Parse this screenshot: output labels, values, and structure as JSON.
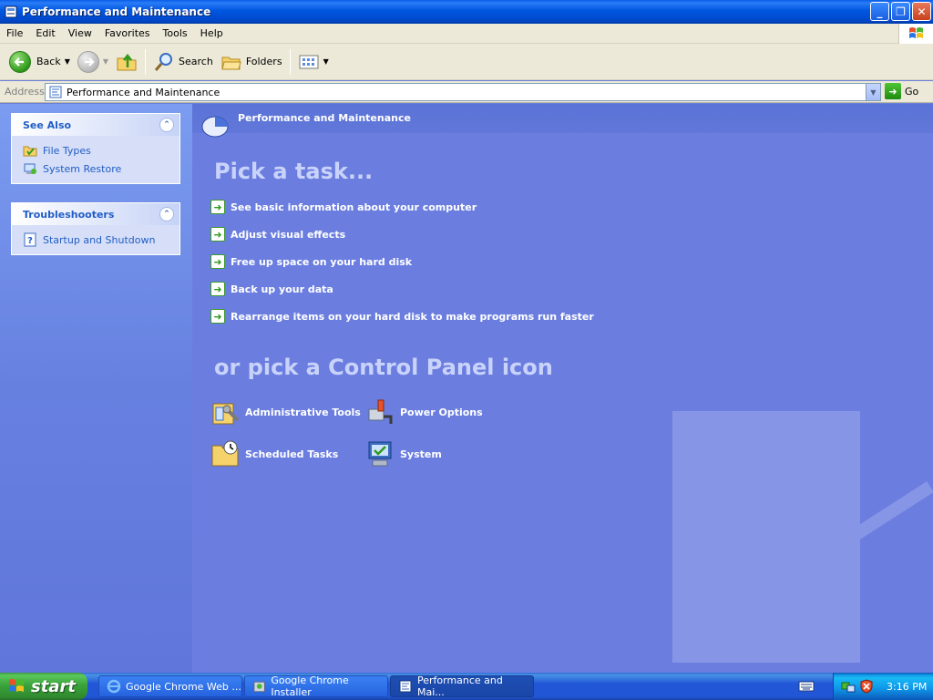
{
  "window": {
    "title": "Performance and Maintenance",
    "buttons": {
      "minimize": "_",
      "maximize": "❐",
      "close": "✕"
    }
  },
  "menu": [
    "File",
    "Edit",
    "View",
    "Favorites",
    "Tools",
    "Help"
  ],
  "toolbar": {
    "back_label": "Back",
    "search_label": "Search",
    "folders_label": "Folders"
  },
  "address": {
    "label": "Address",
    "value": "Performance and Maintenance",
    "go_label": "Go"
  },
  "see_also": {
    "title": "See Also",
    "items": [
      "File Types",
      "System Restore"
    ]
  },
  "troubleshooters": {
    "title": "Troubleshooters",
    "items": [
      "Startup and Shutdown"
    ]
  },
  "main": {
    "header_title": "Performance and Maintenance",
    "pick_task_heading": "Pick a task...",
    "tasks": [
      "See basic information about your computer",
      "Adjust visual effects",
      "Free up space on your hard disk",
      "Back up your data",
      "Rearrange items on your hard disk to make programs run faster"
    ],
    "or_pick_heading": "or pick a Control Panel icon",
    "icons": [
      "Administrative Tools",
      "Power Options",
      "Scheduled Tasks",
      "System"
    ]
  },
  "taskbar": {
    "start_label": "start",
    "tasks": [
      "Google Chrome Web ...",
      "Google Chrome Installer",
      "Performance and Mai..."
    ],
    "clock": "3:16 PM"
  },
  "colors": {
    "titlebar_blue": "#0056e0",
    "main_bg": "#6b7ee0",
    "link_blue": "#215dc6",
    "start_green": "#3ba33b"
  }
}
